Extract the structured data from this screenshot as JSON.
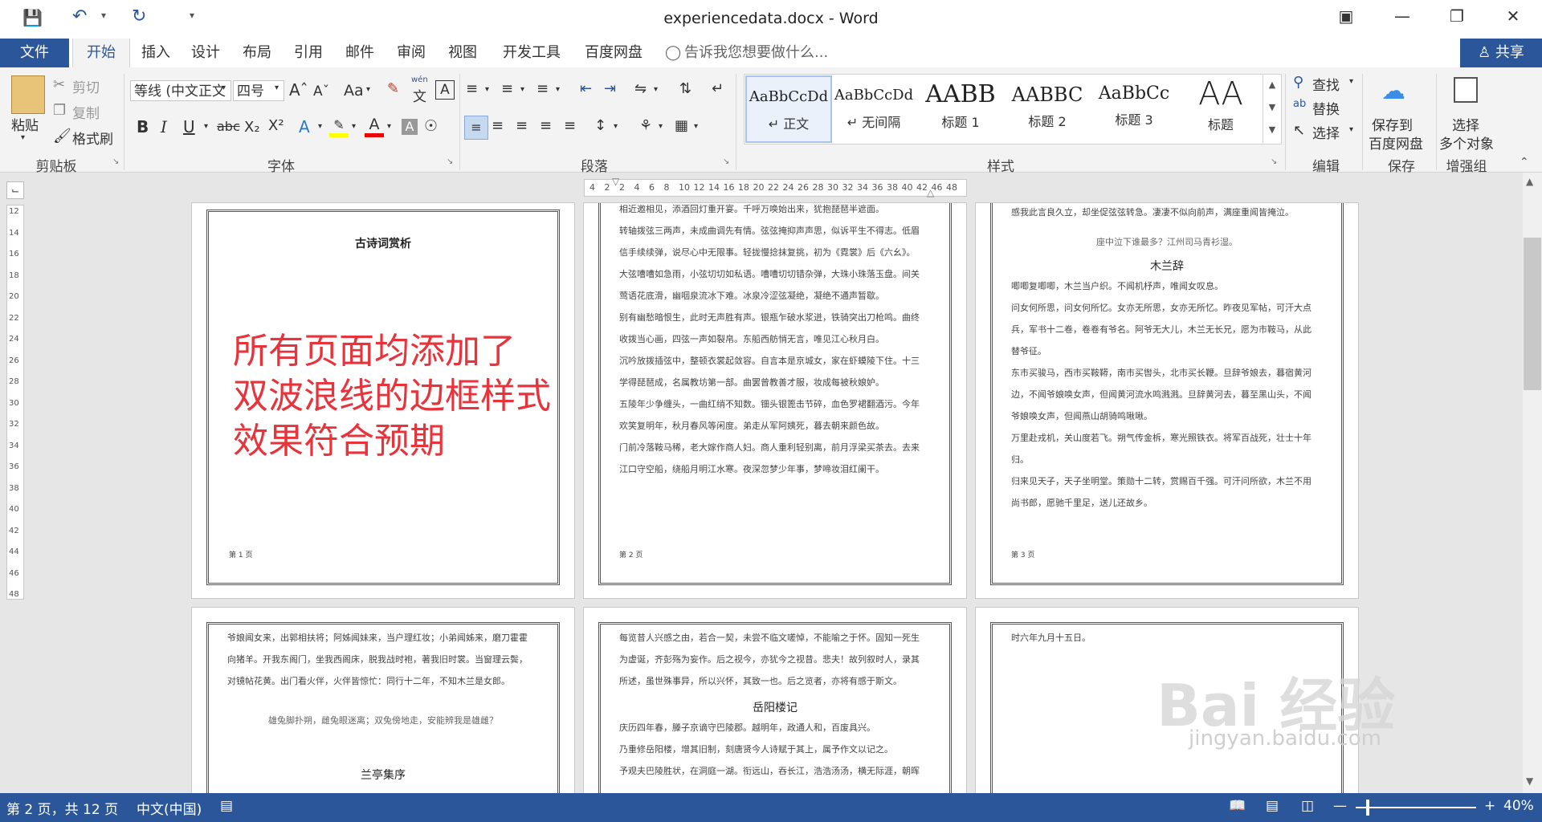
{
  "window": {
    "title": "experiencedata.docx - Word"
  },
  "tabs": {
    "file": "文件",
    "home": "开始",
    "insert": "插入",
    "design": "设计",
    "layout": "布局",
    "references": "引用",
    "mailings": "邮件",
    "review": "审阅",
    "view": "视图",
    "developer": "开发工具",
    "baidu": "百度网盘",
    "tell_me": "告诉我您想要做什么...",
    "share": "共享"
  },
  "clipboard": {
    "paste": "粘贴",
    "cut": "剪切",
    "copy": "复制",
    "format_painter": "格式刷",
    "label": "剪贴板"
  },
  "font": {
    "name": "等线 (中文正文",
    "size": "四号",
    "label": "字体",
    "aa": "Aa",
    "wen": "wén"
  },
  "paragraph": {
    "label": "段落"
  },
  "styles": {
    "label": "样式",
    "items": [
      {
        "sample": "AaBbCcDd",
        "name": "正文"
      },
      {
        "sample": "AaBbCcDd",
        "name": "无间隔"
      },
      {
        "sample": "AABB",
        "name": "标题 1"
      },
      {
        "sample": "AABBC",
        "name": "标题 2"
      },
      {
        "sample": "AaBbCc",
        "name": "标题 3"
      },
      {
        "sample": "AA",
        "name": "标题"
      }
    ]
  },
  "editing": {
    "find": "查找",
    "replace": "替换",
    "select": "选择",
    "label": "编辑"
  },
  "save": {
    "line1": "保存到",
    "line2": "百度网盘",
    "label": "保存"
  },
  "enhance": {
    "line1": "选择",
    "line2": "多个对象",
    "label": "增强组"
  },
  "ruler": {
    "h_ticks": [
      "4",
      "2",
      "2",
      "4",
      "6",
      "8",
      "10",
      "12",
      "14",
      "16",
      "18",
      "20",
      "22",
      "24",
      "26",
      "28",
      "30",
      "32",
      "34",
      "36",
      "38",
      "40",
      "42",
      "46",
      "48"
    ],
    "v_ticks": [
      "12",
      "14",
      "16",
      "18",
      "20",
      "22",
      "24",
      "26",
      "28",
      "30",
      "32",
      "34",
      "36",
      "38",
      "40",
      "42",
      "44",
      "46",
      "48"
    ]
  },
  "pages": {
    "p1": {
      "title": "古诗词赏析",
      "footer": "第 1 页"
    },
    "p2": {
      "lines": [
        "相近邀相见，添酒回灯重开宴。千呼万唤始出来，犹抱琵琶半遮面。",
        "转轴拨弦三两声，未成曲调先有情。弦弦掩抑声声思，似诉平生不得志。低眉",
        "信手续续弹，说尽心中无限事。轻拢慢捻抹复挑，初为《霓裳》后《六幺》。",
        "大弦嘈嘈如急雨，小弦切切如私语。嘈嘈切切错杂弹，大珠小珠落玉盘。间关",
        "莺语花底滑，幽咽泉流冰下难。冰泉冷涩弦凝绝，凝绝不通声暂歇。",
        "别有幽愁暗恨生，此时无声胜有声。银瓶乍破水浆迸，铁骑突出刀枪鸣。曲终",
        "收拨当心画，四弦一声如裂帛。东船西舫悄无言，唯见江心秋月白。",
        "沉吟放拨插弦中，整顿衣裳起敛容。自言本是京城女，家在虾蟆陵下住。十三",
        "学得琵琶成，名属教坊第一部。曲罢曾教善才服，妆成每被秋娘妒。",
        "五陵年少争缠头，一曲红绡不知数。钿头银篦击节碎，血色罗裙翻酒污。今年",
        "欢笑复明年，秋月春风等闲度。弟走从军阿姨死，暮去朝来颜色故。",
        "门前冷落鞍马稀，老大嫁作商人妇。商人重利轻别离，前月浮梁买茶去。去来",
        "江口守空船，绕船月明江水寒。夜深忽梦少年事，梦啼妆泪红阑干。"
      ],
      "footer": "第 2 页"
    },
    "p3": {
      "top_line": "感我此言良久立，却坐促弦弦转急。凄凄不似向前声，满座重闻皆掩泣。",
      "quote": "座中泣下谁最多？江州司马青衫湿。",
      "title": "木兰辞",
      "lines": [
        "唧唧复唧唧，木兰当户织。不闻机杼声，唯闻女叹息。",
        "问女何所思，问女何所忆。女亦无所思，女亦无所忆。昨夜见军帖，可汗大点",
        "兵，军书十二卷，卷卷有爷名。阿爷无大儿，木兰无长兄，愿为市鞍马，从此",
        "替爷征。",
        "东市买骏马，西市买鞍鞯，南市买辔头，北市买长鞭。旦辞爷娘去，暮宿黄河",
        "边，不闻爷娘唤女声，但闻黄河流水鸣溅溅。旦辞黄河去，暮至黑山头，不闻",
        "爷娘唤女声，但闻燕山胡骑鸣啾啾。",
        "万里赴戎机，关山度若飞。朔气传金柝，寒光照铁衣。将军百战死，壮士十年",
        "归。",
        "归来见天子，天子坐明堂。策勋十二转，赏赐百千强。可汗问所欲，木兰不用",
        "尚书郎，愿驰千里足，送儿还故乡。"
      ],
      "footer": "第 3 页"
    },
    "p4": {
      "lines": [
        "爷娘闻女来，出郭相扶将；阿姊闻妹来，当户理红妆；小弟闻姊来，磨刀霍霍",
        "向猪羊。开我东阁门，坐我西阁床，脱我战时袍，著我旧时裳。当窗理云鬓，",
        "对镜帖花黄。出门看火伴，火伴皆惊忙：同行十二年，不知木兰是女郎。"
      ],
      "quote": "雄兔脚扑朔，雌兔眼迷离；双兔傍地走，安能辨我是雄雌？",
      "title": "兰亭集序"
    },
    "p5": {
      "lines": [
        "每览昔人兴感之由，若合一契，未尝不临文嗟悼，不能喻之于怀。固知一死生",
        "为虚诞，齐彭殇为妄作。后之视今，亦犹今之视昔。悲夫！故列叙时人，录其",
        "所述，虽世殊事异，所以兴怀，其致一也。后之览者，亦将有感于斯文。"
      ],
      "title": "岳阳楼记",
      "lines2": [
        "庆历四年春，滕子京谪守巴陵郡。越明年，政通人和，百废具兴。",
        "乃重修岳阳楼，增其旧制，刻唐贤今人诗赋于其上，属予作文以记之。",
        "予观夫巴陵胜状，在洞庭一湖。衔远山，吞长江，浩浩汤汤，横无际涯，朝晖"
      ]
    },
    "p6": {
      "line": "时六年九月十五日。"
    }
  },
  "annotation": [
    "所有页面均添加了",
    "双波浪线的边框样式",
    "效果符合预期"
  ],
  "status": {
    "page": "第 2 页，共 12 页",
    "language": "中文(中国)",
    "zoom": "40%"
  },
  "watermark": {
    "logo": "Bai 经验",
    "url": "jingyan.baidu.com"
  },
  "colors": {
    "accent": "#2b579a",
    "annotation": "#e8333b"
  }
}
